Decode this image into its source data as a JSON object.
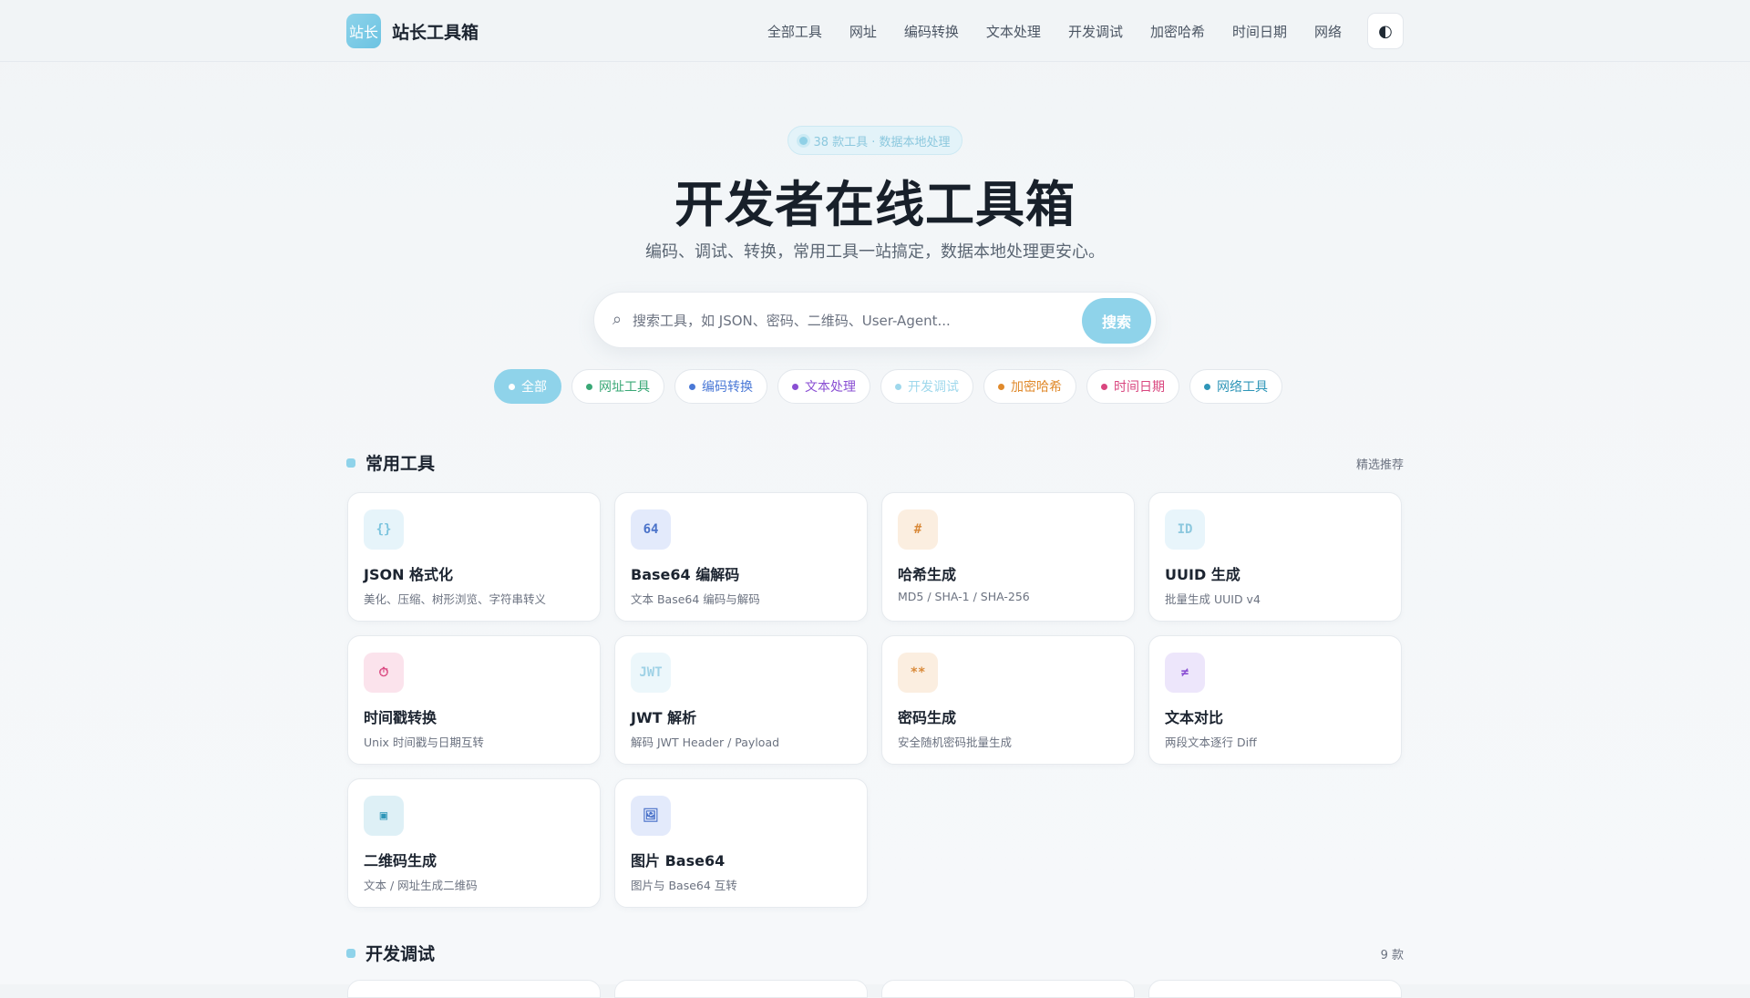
{
  "brand": {
    "logo_text": "站长",
    "name": "站长工具箱"
  },
  "nav": {
    "items": [
      "全部工具",
      "网址",
      "编码转换",
      "文本处理",
      "开发调试",
      "加密哈希",
      "时间日期",
      "网络"
    ],
    "theme_icon": "◐"
  },
  "hero": {
    "badge": "38 款工具 · 数据本地处理",
    "title": "开发者在线工具箱",
    "subtitle": "编码、调试、转换，常用工具一站搞定，数据本地处理更安心。"
  },
  "search": {
    "icon": "⌕",
    "placeholder": "搜索工具，如 JSON、密码、二维码、User-Agent...",
    "button": "搜索"
  },
  "chips": [
    {
      "label": "全部",
      "color": "#ffffff",
      "active": true
    },
    {
      "label": "网址工具",
      "color": "#3aa876"
    },
    {
      "label": "编码转换",
      "color": "#4a78d6"
    },
    {
      "label": "文本处理",
      "color": "#8a4fd3"
    },
    {
      "label": "开发调试",
      "color": "#9fd8ec"
    },
    {
      "label": "加密哈希",
      "color": "#e08a2c"
    },
    {
      "label": "时间日期",
      "color": "#d9467f"
    },
    {
      "label": "网络工具",
      "color": "#2f96b8"
    }
  ],
  "sections": {
    "common": {
      "title": "常用工具",
      "right": "精选推荐"
    },
    "dev": {
      "title": "开发调试",
      "right": "9 款"
    }
  },
  "tools": [
    {
      "icon": "{}",
      "icon_bg": "#e6f4fa",
      "icon_color": "#7cc4de",
      "title": "JSON 格式化",
      "desc": "美化、压缩、树形浏览、字符串转义"
    },
    {
      "icon": "64",
      "icon_bg": "#e3eafb",
      "icon_color": "#4a72c9",
      "title": "Base64 编解码",
      "desc": "文本 Base64 编码与解码"
    },
    {
      "icon": "#",
      "icon_bg": "#fbeee0",
      "icon_color": "#d98a3a",
      "title": "哈希生成",
      "desc": "MD5 / SHA-1 / SHA-256"
    },
    {
      "icon": "ID",
      "icon_bg": "#e8f5fb",
      "icon_color": "#8cc8de",
      "title": "UUID 生成",
      "desc": "批量生成 UUID v4"
    },
    {
      "icon": "⏱",
      "icon_bg": "#fbe3ec",
      "icon_color": "#d9467f",
      "title": "时间戳转换",
      "desc": "Unix 时间戳与日期互转"
    },
    {
      "icon": "JWT",
      "icon_bg": "#ecf7fb",
      "icon_color": "#9fd2e6",
      "title": "JWT 解析",
      "desc": "解码 JWT Header / Payload"
    },
    {
      "icon": "**",
      "icon_bg": "#fbeee0",
      "icon_color": "#d98a3a",
      "title": "密码生成",
      "desc": "安全随机密码批量生成"
    },
    {
      "icon": "≠",
      "icon_bg": "#ede6fb",
      "icon_color": "#8a4fd3",
      "title": "文本对比",
      "desc": "两段文本逐行 Diff"
    },
    {
      "icon": "▣",
      "icon_bg": "#def0f6",
      "icon_color": "#2f96b8",
      "title": "二维码生成",
      "desc": "文本 / 网址生成二维码"
    },
    {
      "icon": "🖼",
      "icon_bg": "#e3eafb",
      "icon_color": "#4a72c9",
      "title": "图片 Base64",
      "desc": "图片与 Base64 互转"
    }
  ]
}
